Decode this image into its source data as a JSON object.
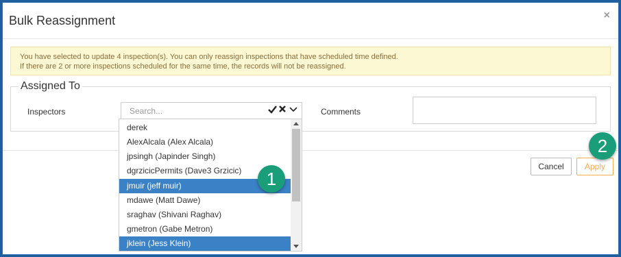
{
  "dialog": {
    "title": "Bulk Reassignment",
    "close_symbol": "×"
  },
  "alert": {
    "line1": "You have selected to update 4 inspection(s). You can only reassign inspections that have scheduled time defined.",
    "line2": "If there are 2 or more inspections scheduled for the same time, the records will not be reassigned."
  },
  "assigned_to": {
    "legend": "Assigned To",
    "inspectors_label": "Inspectors",
    "search_placeholder": "Search...",
    "comments_label": "Comments",
    "comments_value": ""
  },
  "inspector_options": [
    {
      "label": "derek",
      "selected": false
    },
    {
      "label": "AlexAlcala (Alex Alcala)",
      "selected": false
    },
    {
      "label": "jpsingh (Japinder Singh)",
      "selected": false
    },
    {
      "label": "dgrzicicPermits (Dave3 Grzicic)",
      "selected": false
    },
    {
      "label": "jmuir (jeff muir)",
      "selected": true
    },
    {
      "label": "mdawe (Matt Dawe)",
      "selected": false
    },
    {
      "label": "sraghav (Shivani Raghav)",
      "selected": false
    },
    {
      "label": "gmetron (Gabe Metron)",
      "selected": false
    },
    {
      "label": "jklein (Jess Klein)",
      "selected": true
    }
  ],
  "icons": {
    "select_all": "check-icon",
    "clear": "x-icon",
    "toggle": "chevron-down-icon"
  },
  "footer": {
    "cancel_label": "Cancel",
    "apply_label": "Apply"
  },
  "callouts": {
    "step1": "1",
    "step2": "2"
  },
  "colors": {
    "accent_selected": "#3b81c6",
    "apply_warning": "#f0ad4e",
    "callout_green": "#1a9e7a",
    "alert_bg": "#fcf8d3"
  }
}
